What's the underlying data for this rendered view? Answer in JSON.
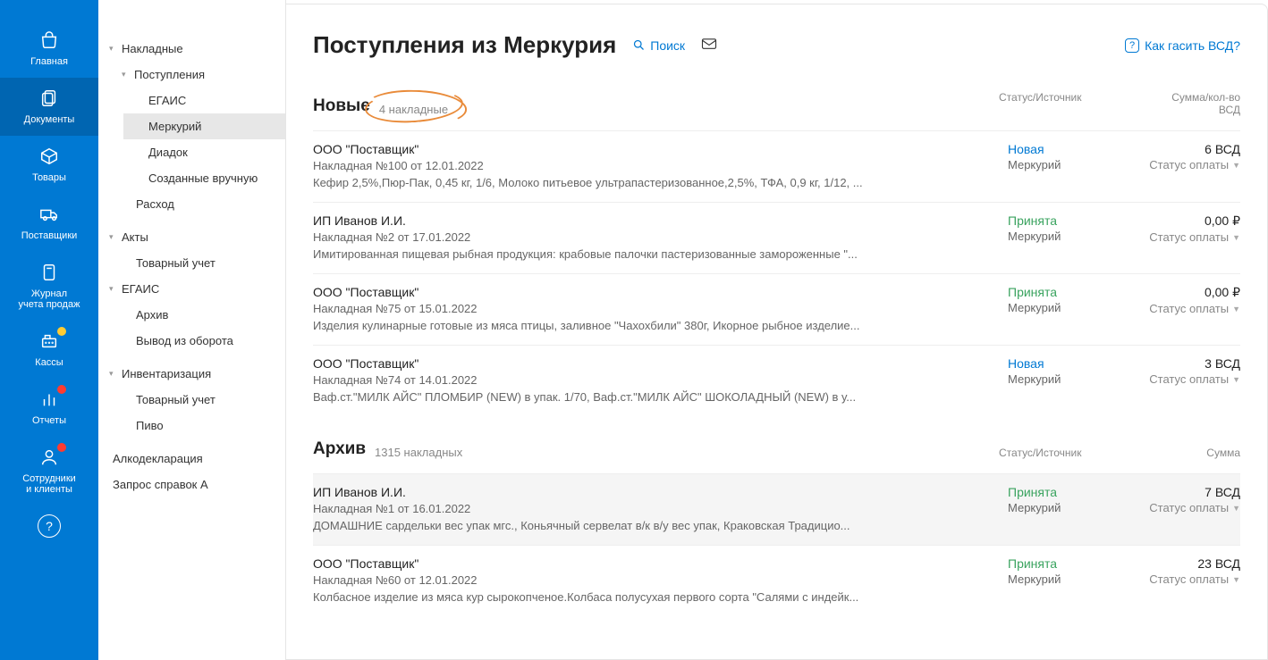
{
  "rail": {
    "items": [
      {
        "label": "Главная"
      },
      {
        "label": "Документы"
      },
      {
        "label": "Товары"
      },
      {
        "label": "Поставщики"
      },
      {
        "label": "Журнал\nучета продаж"
      },
      {
        "label": "Кассы"
      },
      {
        "label": "Отчеты"
      },
      {
        "label": "Сотрудники\nи клиенты"
      }
    ]
  },
  "tree": {
    "nakladnye": "Накладные",
    "postupleniya": "Поступления",
    "egais_leaf": "ЕГАИС",
    "mercury_leaf": "Меркурий",
    "diadoc": "Диадок",
    "manual": "Созданные вручную",
    "rashod": "Расход",
    "akty": "Акты",
    "tovarny_uchet": "Товарный учет",
    "egais_grp": "ЕГАИС",
    "arhiv": "Архив",
    "vyvod": "Вывод из оборота",
    "invent": "Инвентаризация",
    "tovarny_uchet2": "Товарный учет",
    "pivo": "Пиво",
    "alko": "Алкодекларация",
    "zapros": "Запрос справок А"
  },
  "header": {
    "title": "Поступления из Меркурия",
    "search": "Поиск",
    "help": "Как гасить ВСД?"
  },
  "sections": {
    "new": {
      "title": "Новые",
      "count": "4 накладные",
      "col_status": "Статус/Источник",
      "col_sum": "Сумма/кол-во\nВСД"
    },
    "archive": {
      "title": "Архив",
      "count": "1315 накладных",
      "col_status": "Статус/Источник",
      "col_sum": "Сумма"
    }
  },
  "status_labels": {
    "novaya": "Новая",
    "prinyata": "Принята"
  },
  "source_label": "Меркурий",
  "pay_label": "Статус оплаты",
  "rows_new": [
    {
      "title": "ООО \"Поставщик\"",
      "sub": "Накладная №100 от 12.01.2022",
      "desc": "Кефир 2,5%,Пюр-Пак, 0,45 кг, 1/6, Молоко питьевое ультрапастеризованное,2,5%, ТФА, 0,9 кг, 1/12, ...",
      "status": "novaya",
      "amount": "6 ВСД"
    },
    {
      "title": "ИП Иванов И.И.",
      "sub": "Накладная №2 от 17.01.2022",
      "desc": "Имитированная пищевая рыбная продукция: крабовые палочки пастеризованные замороженные \"...",
      "status": "prinyata",
      "amount": "0,00 ₽"
    },
    {
      "title": "ООО \"Поставщик\"",
      "sub": "Накладная №75 от 15.01.2022",
      "desc": "Изделия кулинарные готовые из мяса птицы, заливное \"Чахохбили\" 380г, Икорное рыбное изделие...",
      "status": "prinyata",
      "amount": "0,00 ₽"
    },
    {
      "title": "ООО \"Поставщик\"",
      "sub": "Накладная №74 от 14.01.2022",
      "desc": "Ваф.ст.\"МИЛК АЙС\" ПЛОМБИР (NEW) в упак. 1/70, Ваф.ст.\"МИЛК АЙС\" ШОКОЛАДНЫЙ (NEW) в у...",
      "status": "novaya",
      "amount": "3 ВСД"
    }
  ],
  "rows_archive": [
    {
      "title": "ИП Иванов И.И.",
      "sub": "Накладная №1 от 16.01.2022",
      "desc": "ДОМАШНИЕ сардельки вес упак мгс., Коньячный сервелат в/к в/у вес упак, Краковская Традицио...",
      "status": "prinyata",
      "amount": "7 ВСД",
      "highlighted": true
    },
    {
      "title": "ООО \"Поставщик\"",
      "sub": "Накладная №60 от 12.01.2022",
      "desc": "Колбасное изделие из мяса кур сырокопченое.Колбаса полусухая первого сорта \"Салями с индейк...",
      "status": "prinyata",
      "amount": "23 ВСД"
    }
  ]
}
